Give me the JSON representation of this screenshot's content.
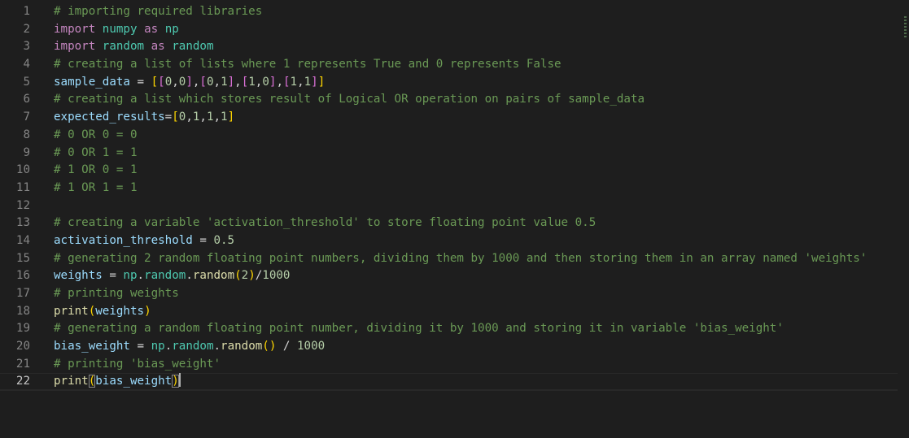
{
  "editor": {
    "current_line": 22,
    "lines": [
      {
        "n": "1",
        "tokens": [
          {
            "t": "# importing required libraries",
            "c": "comment"
          }
        ]
      },
      {
        "n": "2",
        "tokens": [
          {
            "t": "import",
            "c": "kw"
          },
          {
            "t": " ",
            "c": "op"
          },
          {
            "t": "numpy",
            "c": "mod"
          },
          {
            "t": " ",
            "c": "op"
          },
          {
            "t": "as",
            "c": "kw"
          },
          {
            "t": " ",
            "c": "op"
          },
          {
            "t": "np",
            "c": "mod"
          }
        ]
      },
      {
        "n": "3",
        "tokens": [
          {
            "t": "import",
            "c": "kw"
          },
          {
            "t": " ",
            "c": "op"
          },
          {
            "t": "random",
            "c": "mod"
          },
          {
            "t": " ",
            "c": "op"
          },
          {
            "t": "as",
            "c": "kw"
          },
          {
            "t": " ",
            "c": "op"
          },
          {
            "t": "random",
            "c": "mod"
          }
        ]
      },
      {
        "n": "4",
        "tokens": [
          {
            "t": "# creating a list of lists where 1 represents True and 0 represents False",
            "c": "comment"
          }
        ]
      },
      {
        "n": "5",
        "tokens": [
          {
            "t": "sample_data",
            "c": "var"
          },
          {
            "t": " = ",
            "c": "op"
          },
          {
            "t": "[",
            "c": "b1"
          },
          {
            "t": "[",
            "c": "b2"
          },
          {
            "t": "0",
            "c": "num"
          },
          {
            "t": ",",
            "c": "op"
          },
          {
            "t": "0",
            "c": "num"
          },
          {
            "t": "]",
            "c": "b2"
          },
          {
            "t": ",",
            "c": "op"
          },
          {
            "t": "[",
            "c": "b2"
          },
          {
            "t": "0",
            "c": "num"
          },
          {
            "t": ",",
            "c": "op"
          },
          {
            "t": "1",
            "c": "num"
          },
          {
            "t": "]",
            "c": "b2"
          },
          {
            "t": ",",
            "c": "op"
          },
          {
            "t": "[",
            "c": "b2"
          },
          {
            "t": "1",
            "c": "num"
          },
          {
            "t": ",",
            "c": "op"
          },
          {
            "t": "0",
            "c": "num"
          },
          {
            "t": "]",
            "c": "b2"
          },
          {
            "t": ",",
            "c": "op"
          },
          {
            "t": "[",
            "c": "b2"
          },
          {
            "t": "1",
            "c": "num"
          },
          {
            "t": ",",
            "c": "op"
          },
          {
            "t": "1",
            "c": "num"
          },
          {
            "t": "]",
            "c": "b2"
          },
          {
            "t": "]",
            "c": "b1"
          }
        ]
      },
      {
        "n": "6",
        "tokens": [
          {
            "t": "# creating a list which stores result of Logical OR operation on pairs of sample_data",
            "c": "comment"
          }
        ]
      },
      {
        "n": "7",
        "tokens": [
          {
            "t": "expected_results",
            "c": "var"
          },
          {
            "t": "=",
            "c": "op"
          },
          {
            "t": "[",
            "c": "b1"
          },
          {
            "t": "0",
            "c": "num"
          },
          {
            "t": ",",
            "c": "op"
          },
          {
            "t": "1",
            "c": "num"
          },
          {
            "t": ",",
            "c": "op"
          },
          {
            "t": "1",
            "c": "num"
          },
          {
            "t": ",",
            "c": "op"
          },
          {
            "t": "1",
            "c": "num"
          },
          {
            "t": "]",
            "c": "b1"
          }
        ]
      },
      {
        "n": "8",
        "tokens": [
          {
            "t": "# 0 OR 0 = 0",
            "c": "comment"
          }
        ]
      },
      {
        "n": "9",
        "tokens": [
          {
            "t": "# 0 OR 1 = 1",
            "c": "comment"
          }
        ]
      },
      {
        "n": "10",
        "tokens": [
          {
            "t": "# 1 OR 0 = 1",
            "c": "comment"
          }
        ]
      },
      {
        "n": "11",
        "tokens": [
          {
            "t": "# 1 OR 1 = 1",
            "c": "comment"
          }
        ]
      },
      {
        "n": "12",
        "tokens": []
      },
      {
        "n": "13",
        "tokens": [
          {
            "t": "# creating a variable 'activation_threshold' to store floating point value 0.5",
            "c": "comment"
          }
        ]
      },
      {
        "n": "14",
        "tokens": [
          {
            "t": "activation_threshold",
            "c": "var"
          },
          {
            "t": " = ",
            "c": "op"
          },
          {
            "t": "0.5",
            "c": "num"
          }
        ]
      },
      {
        "n": "15",
        "tokens": [
          {
            "t": "# generating 2 random floating point numbers, dividing them by 1000 and then storing them in an array named 'weights'",
            "c": "comment"
          }
        ]
      },
      {
        "n": "16",
        "tokens": [
          {
            "t": "weights",
            "c": "var"
          },
          {
            "t": " = ",
            "c": "op"
          },
          {
            "t": "np",
            "c": "mod"
          },
          {
            "t": ".",
            "c": "op"
          },
          {
            "t": "random",
            "c": "mod"
          },
          {
            "t": ".",
            "c": "op"
          },
          {
            "t": "random",
            "c": "fn"
          },
          {
            "t": "(",
            "c": "b1"
          },
          {
            "t": "2",
            "c": "num"
          },
          {
            "t": ")",
            "c": "b1"
          },
          {
            "t": "/",
            "c": "op"
          },
          {
            "t": "1000",
            "c": "num"
          }
        ]
      },
      {
        "n": "17",
        "tokens": [
          {
            "t": "# printing weights",
            "c": "comment"
          }
        ]
      },
      {
        "n": "18",
        "tokens": [
          {
            "t": "print",
            "c": "fn"
          },
          {
            "t": "(",
            "c": "b1"
          },
          {
            "t": "weights",
            "c": "var"
          },
          {
            "t": ")",
            "c": "b1"
          }
        ]
      },
      {
        "n": "19",
        "tokens": [
          {
            "t": "# generating a random floating point number, dividing it by 1000 and storing it in variable 'bias_weight'",
            "c": "comment"
          }
        ]
      },
      {
        "n": "20",
        "tokens": [
          {
            "t": "bias_weight",
            "c": "var"
          },
          {
            "t": " = ",
            "c": "op"
          },
          {
            "t": "np",
            "c": "mod"
          },
          {
            "t": ".",
            "c": "op"
          },
          {
            "t": "random",
            "c": "mod"
          },
          {
            "t": ".",
            "c": "op"
          },
          {
            "t": "random",
            "c": "fn"
          },
          {
            "t": "()",
            "c": "b1"
          },
          {
            "t": " / ",
            "c": "op"
          },
          {
            "t": "1000",
            "c": "num"
          }
        ]
      },
      {
        "n": "21",
        "tokens": [
          {
            "t": "# printing 'bias_weight'",
            "c": "comment"
          }
        ]
      },
      {
        "n": "22",
        "tokens": [
          {
            "t": "print",
            "c": "fn"
          },
          {
            "t": "(",
            "c": "b1 bracket-match"
          },
          {
            "t": "bias_weight",
            "c": "var"
          },
          {
            "t": ")",
            "c": "b1 bracket-match"
          },
          {
            "t": "",
            "c": "cursor"
          }
        ]
      }
    ]
  },
  "colors": {
    "background": "#1e1e1e",
    "comment": "#6a9955",
    "keyword": "#c586c0",
    "module": "#4ec9b0",
    "variable": "#9cdcfe",
    "number": "#b5cea8",
    "function": "#dcdcaa",
    "bracket_level1": "#ffd700",
    "bracket_level2": "#da70d6"
  }
}
